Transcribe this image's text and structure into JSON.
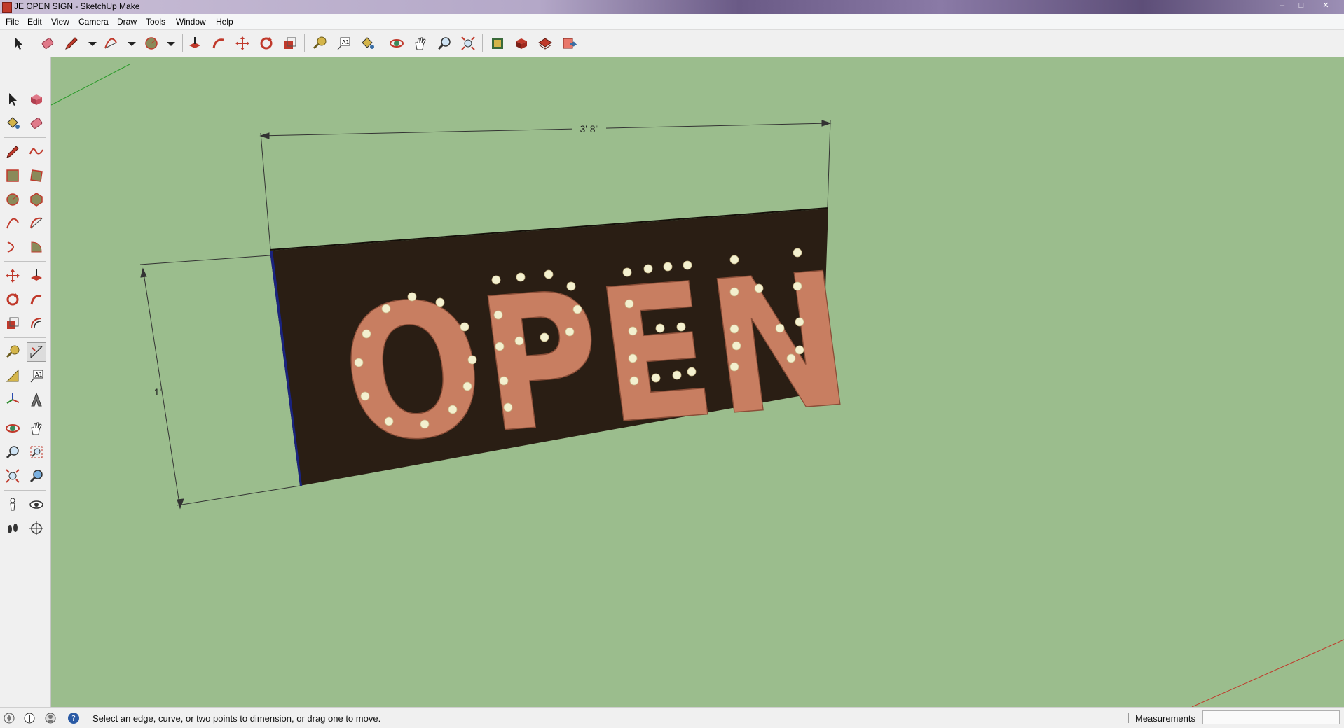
{
  "window": {
    "title": "JE OPEN SIGN - SketchUp Make"
  },
  "menu": {
    "items": [
      "File",
      "Edit",
      "View",
      "Camera",
      "Draw",
      "Tools",
      "Window",
      "Help"
    ]
  },
  "model": {
    "sign_text": "OPEN",
    "dimension_width": "3' 8\"",
    "dimension_height": "1'"
  },
  "statusbar": {
    "message": "Select an edge, curve, or two points to dimension, or drag one to move.",
    "measurements_label": "Measurements",
    "measurements_value": ""
  },
  "colors": {
    "viewport_bg": "#9bbd8d",
    "sign_board": "#2a1e14",
    "letter_fill": "#c87e61",
    "bulb": "#f3f0cf"
  },
  "icons": {
    "toolbar": [
      "select",
      "eraser",
      "pencil",
      "arc",
      "circle",
      "push-pull",
      "follow-me",
      "move",
      "rotate",
      "scale",
      "tape-measure",
      "text",
      "paint",
      "orbit",
      "pan",
      "zoom",
      "zoom-extents",
      "warehouse",
      "components",
      "styles",
      "layout"
    ]
  }
}
